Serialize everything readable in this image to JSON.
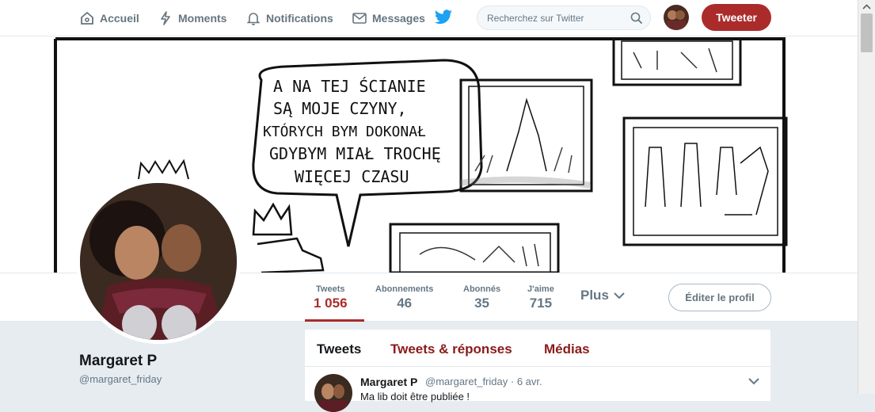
{
  "nav": {
    "home": "Accueil",
    "moments": "Moments",
    "notifications": "Notifications",
    "messages": "Messages"
  },
  "search": {
    "placeholder": "Recherchez sur Twitter"
  },
  "tweet_button": "Tweeter",
  "banner": {
    "speech": [
      "A NA TEJ ŚCIANIE",
      "SĄ MOJE CZYNY,",
      "KTÓRYCH BYM DOKONAŁ",
      "GDYBYM MIAŁ TROCHĘ",
      "WIĘCEJ CZASU"
    ]
  },
  "profile": {
    "name": "Margaret P",
    "handle": "@margaret_friday"
  },
  "stats": [
    {
      "label": "Tweets",
      "value": "1 056"
    },
    {
      "label": "Abonnements",
      "value": "46"
    },
    {
      "label": "Abonnés",
      "value": "35"
    },
    {
      "label": "J'aime",
      "value": "715"
    }
  ],
  "more_label": "Plus",
  "edit_profile": "Éditer le profil",
  "tabs": [
    "Tweets",
    "Tweets & réponses",
    "Médias"
  ],
  "tweet": {
    "name": "Margaret P",
    "handle": "@margaret_friday",
    "date": "6 avr.",
    "text": "Ma lib doit être publiée !"
  },
  "colors": {
    "accent": "#ab2b2b",
    "twitter_blue": "#1da1f2",
    "muted": "#657786"
  }
}
